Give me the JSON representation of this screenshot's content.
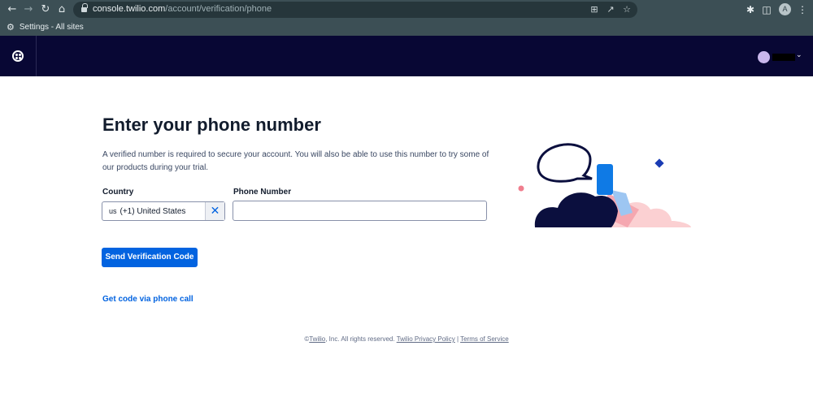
{
  "browser": {
    "url_host": "console.twilio.com",
    "url_path": "/account/verification/phone",
    "bookmark_label": "Settings - All sites",
    "profile_initial": "A"
  },
  "page": {
    "title": "Enter your phone number",
    "description": "A verified number is required to secure your account. You will also be able to use this number to try some of our products during your trial.",
    "country_label": "Country",
    "country_code": "us",
    "country_value": "(+1) United States",
    "phone_label": "Phone Number",
    "phone_value": "",
    "send_button": "Send Verification Code",
    "call_link": "Get code via phone call"
  },
  "footer": {
    "copyright": "©",
    "brand": "Twilio",
    "rights": ", Inc. All rights reserved.",
    "privacy": "Twilio Privacy Policy",
    "separator": "|",
    "terms": "Terms of Service"
  },
  "colors": {
    "header_bg": "#080734",
    "primary": "#0263e0",
    "chrome_bg": "#3c4f55"
  }
}
